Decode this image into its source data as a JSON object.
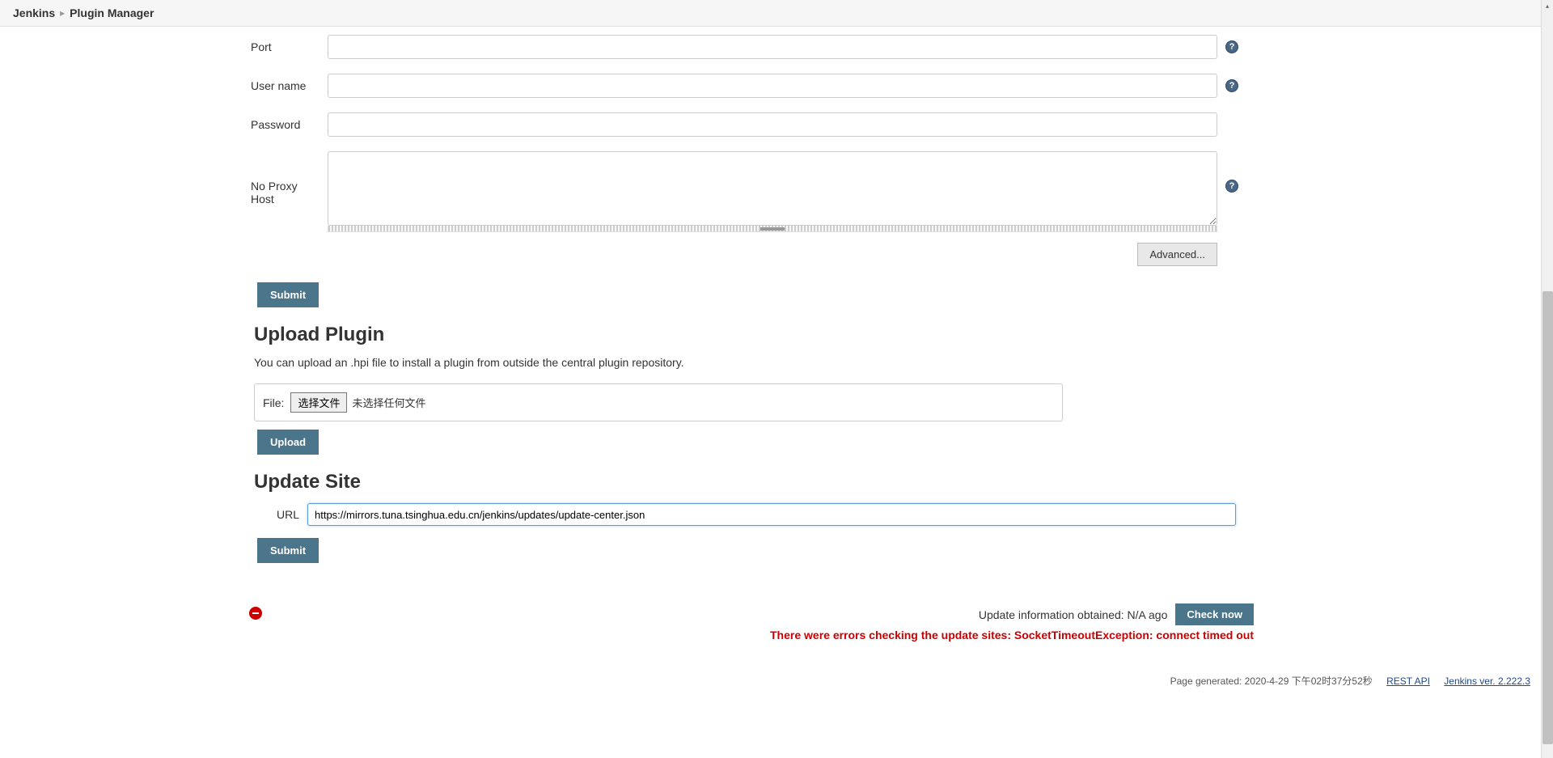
{
  "breadcrumb": {
    "items": [
      "Jenkins",
      "Plugin Manager"
    ]
  },
  "proxy_form": {
    "port_label": "Port",
    "port_value": "",
    "username_label": "User name",
    "username_value": "",
    "password_label": "Password",
    "password_value": "",
    "noproxy_label": "No Proxy Host",
    "noproxy_value": "",
    "advanced_label": "Advanced...",
    "submit_label": "Submit"
  },
  "upload_section": {
    "title": "Upload Plugin",
    "description": "You can upload an .hpi file to install a plugin from outside the central plugin repository.",
    "file_label": "File:",
    "choose_file_label": "选择文件",
    "file_status": "未选择任何文件",
    "upload_label": "Upload"
  },
  "update_site": {
    "title": "Update Site",
    "url_label": "URL",
    "url_value": "https://mirrors.tuna.tsinghua.edu.cn/jenkins/updates/update-center.json",
    "submit_label": "Submit"
  },
  "footer_info": {
    "update_obtained": "Update information obtained: N/A ago",
    "check_now_label": "Check now",
    "error_text": "There were errors checking the update sites: SocketTimeoutException: connect timed out"
  },
  "page_footer": {
    "generated": "Page generated: 2020-4-29 下午02时37分52秒",
    "rest_api": "REST API",
    "jenkins_ver": "Jenkins ver. 2.222.3"
  }
}
